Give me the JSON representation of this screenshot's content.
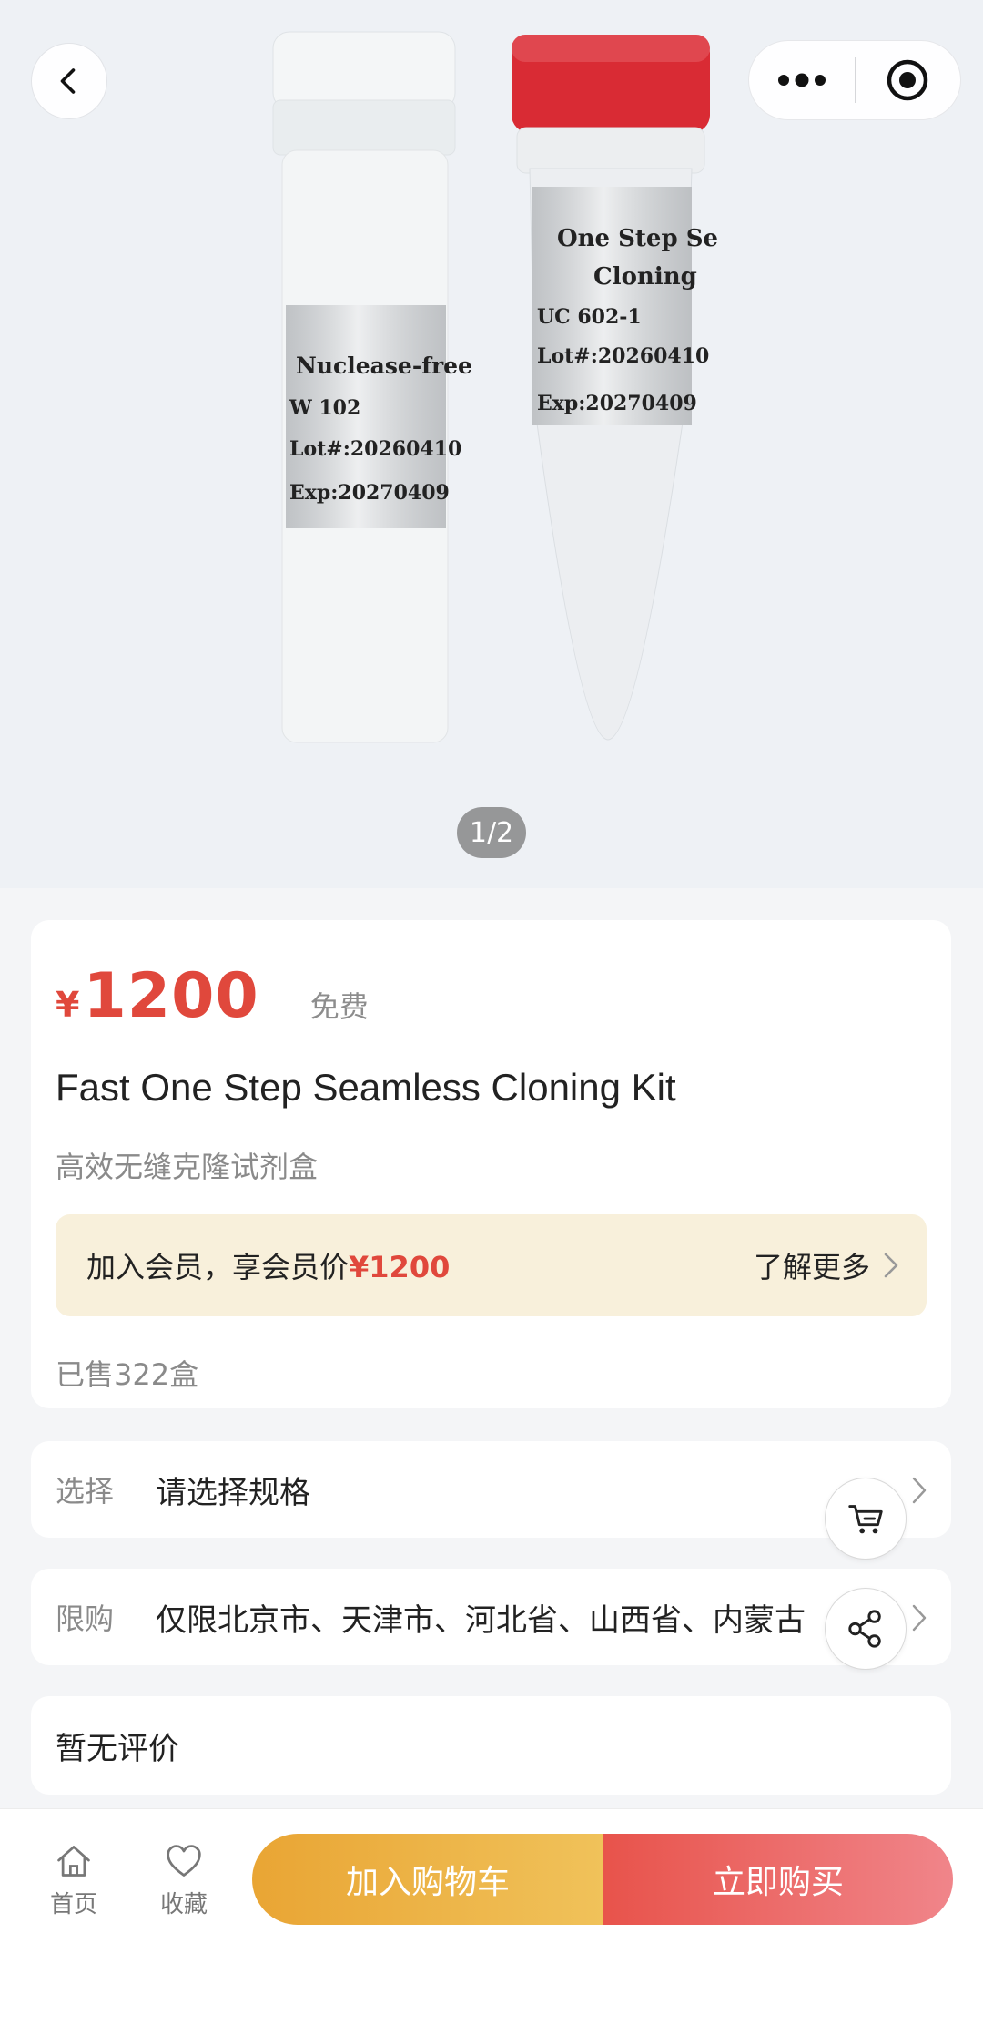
{
  "hero": {
    "page_indicator": "1/2",
    "left_tube_label": [
      "Nuclease-free",
      "W 102",
      "Lot#:20260410",
      "Exp:20270409"
    ],
    "right_tube_label": [
      "One Step Se",
      "Cloning",
      "UC 602-1",
      "Lot#:20260410",
      "Exp:20270409"
    ]
  },
  "price_card": {
    "currency": "¥",
    "price": "1200",
    "shipping": "免费",
    "title_en": "Fast One Step Seamless Cloning Kit",
    "subtitle": "高效无缝克隆试剂盒",
    "member_prefix": "加入会员，享会员价",
    "member_price": "¥1200",
    "member_more": "了解更多",
    "sold": "已售322盒"
  },
  "spec": {
    "label": "选择",
    "value": "请选择规格"
  },
  "limit": {
    "label": "限购",
    "value": "仅限北京市、天津市、河北省、山西省、内蒙古"
  },
  "review": {
    "text": "暂无评价"
  },
  "bottom_bar": {
    "home": "首页",
    "favorite": "收藏",
    "add_to_cart": "加入购物车",
    "buy_now": "立即购买"
  },
  "colors": {
    "accent_red": "#e0483c",
    "member_bg": "#f8f0db",
    "cart_button": "#e9a534",
    "buy_button": "#e8534b"
  },
  "icons": {
    "back": "chevron-left-icon",
    "more": "more-dots-icon",
    "close": "target-icon",
    "cart": "cart-icon",
    "share": "share-icon",
    "home": "home-icon",
    "favorite": "heart-icon"
  }
}
